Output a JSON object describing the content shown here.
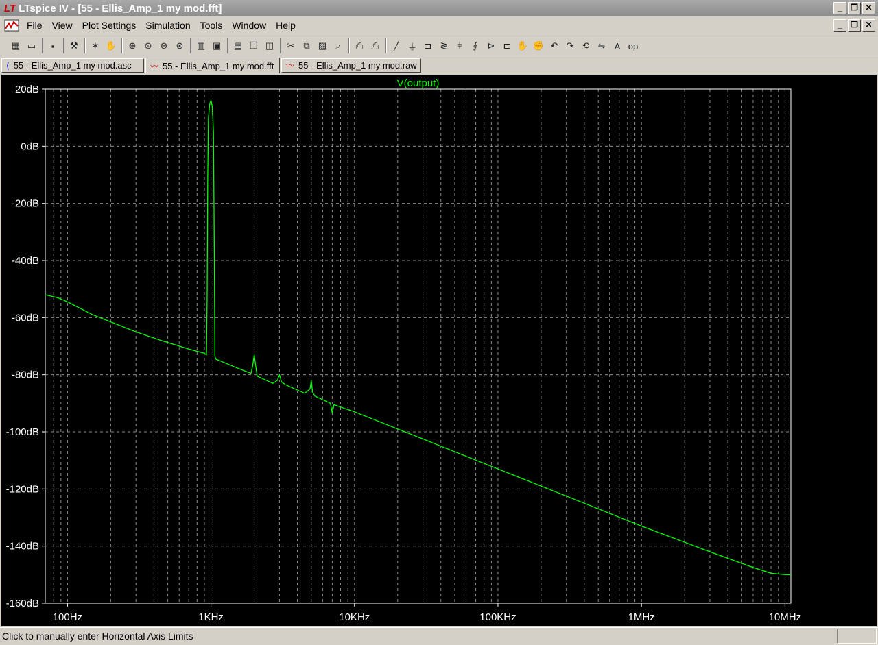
{
  "window": {
    "title": "LTspice IV - [55 - Ellis_Amp_1 my mod.fft]",
    "controls": [
      "_",
      "❐",
      "✕"
    ]
  },
  "menu": {
    "items": [
      "File",
      "View",
      "Plot Settings",
      "Simulation",
      "Tools",
      "Window",
      "Help"
    ],
    "mdi_controls": [
      "_",
      "❐",
      "✕"
    ]
  },
  "toolbar": {
    "groups": [
      [
        "new-schematic-icon",
        "open-icon"
      ],
      [
        "save-icon"
      ],
      [
        "control-panel-icon"
      ],
      [
        "run-icon",
        "halt-icon"
      ],
      [
        "zoom-in-icon",
        "zoom-area-icon",
        "zoom-out-icon",
        "zoom-cancel-icon"
      ],
      [
        "autorange-icon",
        "grid-icon"
      ],
      [
        "tile-horizontal-icon",
        "cascade-icon",
        "tile-vertical-icon"
      ],
      [
        "cut-icon",
        "copy-icon",
        "paste-icon",
        "find-icon"
      ],
      [
        "print-preview-icon",
        "print-icon"
      ],
      [
        "wire-icon",
        "ground-icon",
        "label-icon",
        "resistor-icon",
        "capacitor-icon",
        "inductor-icon",
        "diode-icon",
        "component-icon",
        "move-icon",
        "drag-icon",
        "undo-icon",
        "redo-icon",
        "rotate-icon",
        "mirror-icon",
        "text-icon",
        "spice-directive-icon"
      ]
    ]
  },
  "tabs": [
    {
      "label": "55 - Ellis_Amp_1 my mod.asc",
      "icon": "schematic-icon",
      "active": false
    },
    {
      "label": "55 - Ellis_Amp_1 my mod.fft",
      "icon": "waveform-icon",
      "active": true
    },
    {
      "label": "55 - Ellis_Amp_1 my mod.raw",
      "icon": "waveform-icon",
      "active": false
    }
  ],
  "chart_data": {
    "type": "line",
    "title": "V(output)",
    "xscale": "log",
    "x_ticks": [
      {
        "value": 100,
        "label": "100Hz"
      },
      {
        "value": 1000,
        "label": "1KHz"
      },
      {
        "value": 10000,
        "label": "10KHz"
      },
      {
        "value": 100000,
        "label": "100KHz"
      },
      {
        "value": 1000000,
        "label": "1MHz"
      },
      {
        "value": 10000000,
        "label": "10MHz"
      }
    ],
    "y_ticks": [
      {
        "value": 20,
        "label": "20dB"
      },
      {
        "value": 0,
        "label": "0dB"
      },
      {
        "value": -20,
        "label": "-20dB"
      },
      {
        "value": -40,
        "label": "-40dB"
      },
      {
        "value": -60,
        "label": "-60dB"
      },
      {
        "value": -80,
        "label": "-80dB"
      },
      {
        "value": -100,
        "label": "-100dB"
      },
      {
        "value": -120,
        "label": "-120dB"
      },
      {
        "value": -140,
        "label": "-140dB"
      },
      {
        "value": -160,
        "label": "-160dB"
      }
    ],
    "xlim": [
      70,
      11000000
    ],
    "ylim": [
      -160,
      20
    ],
    "grid": true,
    "colors": {
      "background": "#000000",
      "trace": "#00ff00",
      "axes": "#ffffff",
      "grid": "#8c8c8c",
      "title": "#00ff00"
    },
    "series": [
      {
        "name": "V(output)",
        "points": [
          [
            70,
            -52
          ],
          [
            85,
            -53
          ],
          [
            100,
            -54.5
          ],
          [
            120,
            -56.5
          ],
          [
            150,
            -59
          ],
          [
            200,
            -61.5
          ],
          [
            300,
            -65
          ],
          [
            450,
            -68
          ],
          [
            700,
            -71
          ],
          [
            900,
            -72.5
          ],
          [
            930,
            -73
          ],
          [
            940,
            -52
          ],
          [
            950,
            -10
          ],
          [
            960,
            10
          ],
          [
            980,
            15
          ],
          [
            1000,
            16
          ],
          [
            1020,
            14
          ],
          [
            1040,
            5
          ],
          [
            1055,
            -40
          ],
          [
            1065,
            -73.5
          ],
          [
            1080,
            -74.5
          ],
          [
            1500,
            -77.5
          ],
          [
            1900,
            -79.5
          ],
          [
            1950,
            -77
          ],
          [
            2000,
            -73
          ],
          [
            2050,
            -77
          ],
          [
            2100,
            -80.5
          ],
          [
            2700,
            -83
          ],
          [
            2900,
            -82
          ],
          [
            3000,
            -80
          ],
          [
            3100,
            -82.5
          ],
          [
            3300,
            -83.5
          ],
          [
            4500,
            -86.5
          ],
          [
            4900,
            -85
          ],
          [
            5000,
            -82
          ],
          [
            5100,
            -86
          ],
          [
            5300,
            -87.5
          ],
          [
            6800,
            -90
          ],
          [
            7000,
            -93.5
          ],
          [
            7200,
            -90.5
          ],
          [
            10000,
            -93
          ],
          [
            30000,
            -102.5
          ],
          [
            100000,
            -113
          ],
          [
            300000,
            -122.5
          ],
          [
            1000000,
            -133
          ],
          [
            3000000,
            -142
          ],
          [
            6000000,
            -147.5
          ],
          [
            8000000,
            -149.5
          ],
          [
            10000000,
            -150
          ],
          [
            11000000,
            -150
          ]
        ]
      }
    ]
  },
  "status": {
    "message": "Click to manually enter Horizontal Axis Limits"
  }
}
